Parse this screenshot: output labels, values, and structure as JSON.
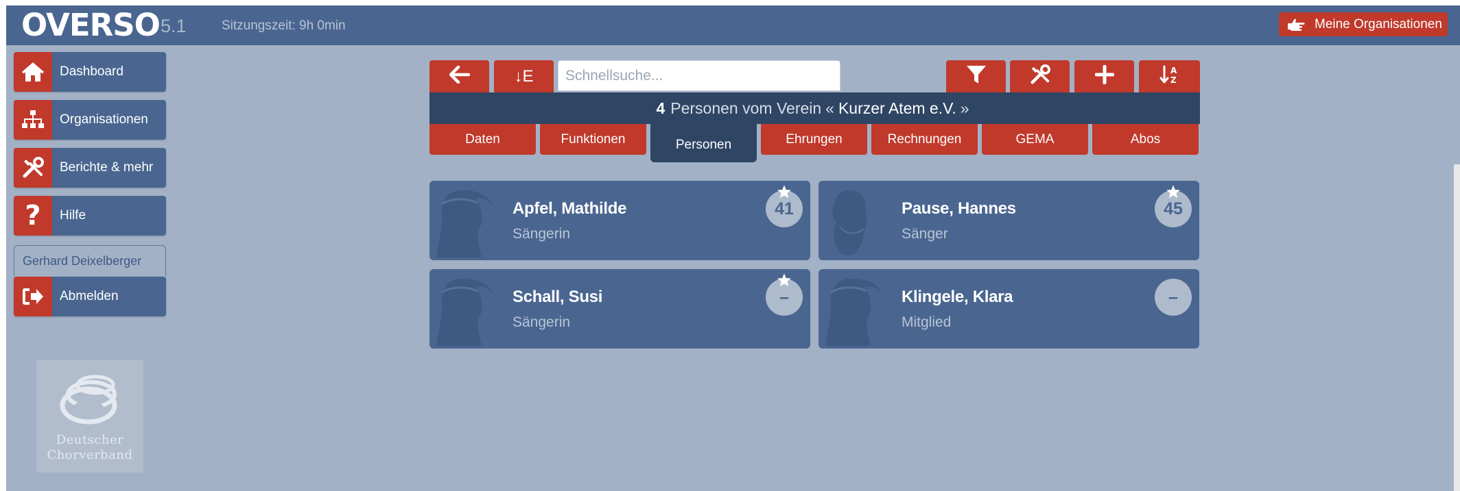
{
  "app": {
    "logo": "OVERSO",
    "version": "5.1",
    "session": "Sitzungszeit: 9h 0min",
    "my_orgs_label": "Meine Organisationen"
  },
  "nav": {
    "items": [
      {
        "label": "Dashboard",
        "icon": "home-icon"
      },
      {
        "label": "Organisationen",
        "icon": "sitemap-icon"
      },
      {
        "label": "Berichte & mehr",
        "icon": "tools-icon"
      },
      {
        "label": "Hilfe",
        "icon": "question-icon"
      }
    ],
    "user_name": "Gerhard Deixelberger",
    "logout_label": "Abmelden"
  },
  "brand_logo": {
    "line1": "Deutscher",
    "line2": "Chorverband"
  },
  "toolbar": {
    "back_icon": "arrow-left-icon",
    "sort_label": "↓E",
    "search_placeholder": "Schnellsuche...",
    "search_value": "",
    "filter_icon": "filter-icon",
    "tools_icon": "tools-icon",
    "add_icon": "plus-icon",
    "sort_az_icon": "sort-alpha-icon"
  },
  "header": {
    "count": "4",
    "text": "Personen vom Verein",
    "quote_open": "«",
    "club": "Kurzer Atem e.V.",
    "quote_close": "»"
  },
  "tabs": [
    {
      "label": "Daten",
      "active": false
    },
    {
      "label": "Funktionen",
      "active": false
    },
    {
      "label": "Personen",
      "active": true
    },
    {
      "label": "Ehrungen",
      "active": false
    },
    {
      "label": "Rechnungen",
      "active": false
    },
    {
      "label": "GEMA",
      "active": false
    },
    {
      "label": "Abos",
      "active": false
    }
  ],
  "persons": [
    {
      "name": "Apfel, Mathilde",
      "role": "Sängerin",
      "badge": "41",
      "starred": true,
      "avatar": "female-silhouette-icon"
    },
    {
      "name": "Pause, Hannes",
      "role": "Sänger",
      "badge": "45",
      "starred": true,
      "avatar": "male-silhouette-icon"
    },
    {
      "name": "Schall, Susi",
      "role": "Sängerin",
      "badge": "–",
      "starred": true,
      "avatar": "female-silhouette-icon"
    },
    {
      "name": "Klingele, Klara",
      "role": "Mitglied",
      "badge": "–",
      "starred": false,
      "avatar": "female-silhouette-icon"
    }
  ],
  "colors": {
    "accent_red": "#c0392b",
    "nav_blue": "#4a6690",
    "dark_blue": "#2f4564",
    "background": "#a2b1c6"
  }
}
